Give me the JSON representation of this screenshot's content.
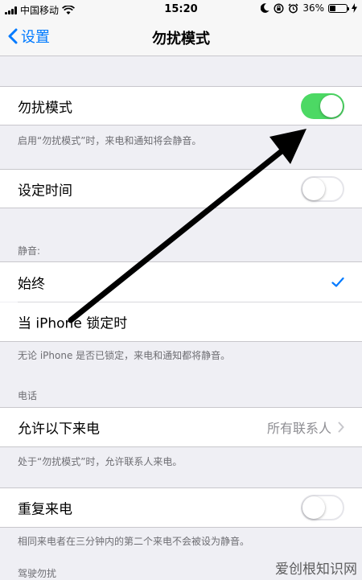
{
  "status": {
    "carrier": "中国移动",
    "time": "15:20",
    "battery": "36%"
  },
  "nav": {
    "back_label": "设置",
    "title": "勿扰模式"
  },
  "dnd": {
    "label": "勿扰模式",
    "on": true,
    "footer": "启用“勿扰模式”时，来电和通知将会静音。"
  },
  "scheduled": {
    "label": "设定时间",
    "on": false
  },
  "silence": {
    "header": "静音:",
    "always": "始终",
    "locked": "当 iPhone 锁定时",
    "footer": "无论 iPhone 是否已锁定，来电和通知都将静音。"
  },
  "phone": {
    "header": "电话",
    "allow_calls_label": "允许以下来电",
    "allow_calls_value": "所有联系人",
    "footer": "处于“勿扰模式”时，允许联系人来电。"
  },
  "repeated": {
    "label": "重复来电",
    "on": false,
    "footer": "相同来电者在三分钟内的第二个来电不会被设为静音。"
  },
  "driving": {
    "header": "驾驶勿扰"
  },
  "watermark": "爱创根知识网",
  "colors": {
    "accent": "#007aff",
    "toggle_on": "#4cd964",
    "annotation_arrow": "#000000"
  }
}
